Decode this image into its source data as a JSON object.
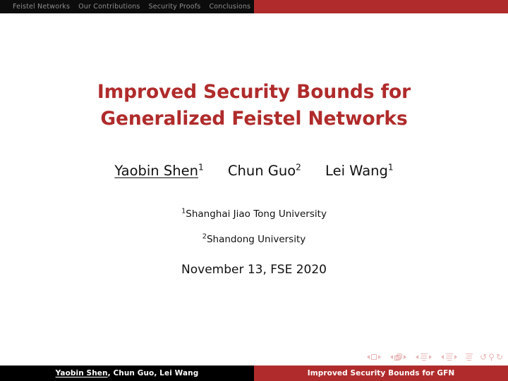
{
  "slide": {
    "type": "beamer-title-slide",
    "background_color": "#ffffff"
  },
  "colors": {
    "structure_red": "#b02c2c",
    "title_red": "#b02b2b",
    "navbar_dark": "#0c0c0c",
    "navbar_text": "#8e8e8e",
    "footer_black": "#000000",
    "footer_text": "#ffffff",
    "navsym": "#e8b6b6",
    "body_text": "#111111"
  },
  "headbar": {
    "sections": [
      {
        "label": "Feistel Networks"
      },
      {
        "label": "Our Contributions"
      },
      {
        "label": "Security Proofs"
      },
      {
        "label": "Conclusions"
      }
    ]
  },
  "title": {
    "text": "Improved Security Bounds for Generalized Feistel Networks"
  },
  "authors": [
    {
      "name": "Yaobin Shen",
      "affiliation_mark": "1",
      "is_speaker": true
    },
    {
      "name": "Chun Guo",
      "affiliation_mark": "2",
      "is_speaker": false
    },
    {
      "name": "Lei Wang",
      "affiliation_mark": "1",
      "is_speaker": false
    }
  ],
  "institutes": [
    {
      "mark": "1",
      "name": "Shanghai Jiao Tong University"
    },
    {
      "mark": "2",
      "name": "Shandong University"
    }
  ],
  "date": {
    "text": "November 13, FSE 2020"
  },
  "nav_symbols": {
    "groups": [
      {
        "name": "slide",
        "icon": "square-icon"
      },
      {
        "name": "frame",
        "icon": "stacked-frames-icon"
      },
      {
        "name": "subsection",
        "icon": "lines-icon"
      },
      {
        "name": "section",
        "icon": "lines-icon"
      }
    ],
    "doc": {
      "name": "presentation",
      "icon": "lines-icon"
    },
    "back": "↺",
    "search": "⚲",
    "forward": "↻"
  },
  "footline": {
    "left_speaker": "Yaobin Shen",
    "left_rest": ", Chun Guo, Lei Wang",
    "right_title": "Improved Security Bounds for GFN"
  }
}
